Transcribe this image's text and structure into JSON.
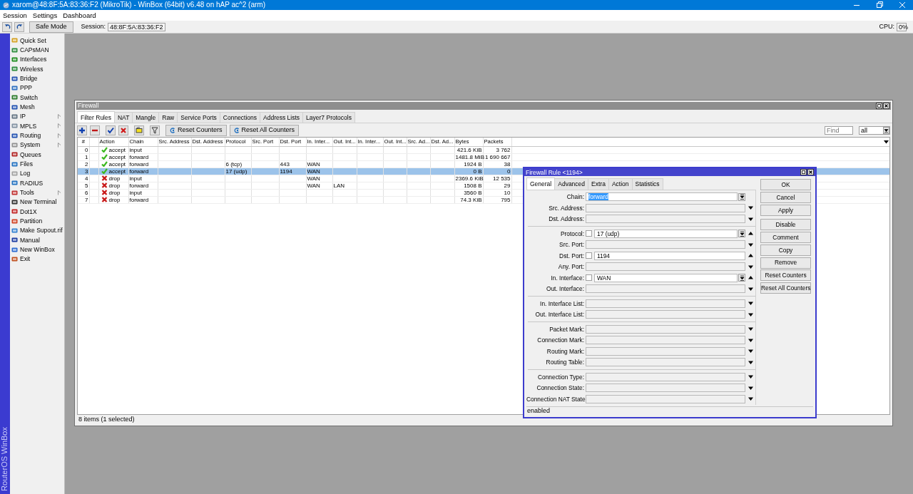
{
  "window": {
    "title": "xarom@48:8F:5A:83:36:F2 (MikroTik) - WinBox (64bit) v6.48 on hAP ac^2 (arm)"
  },
  "menu": [
    "Session",
    "Settings",
    "Dashboard"
  ],
  "toolbar": {
    "safe_mode": "Safe Mode",
    "session_label": "Session:",
    "session": "48:8F:5A:83:36:F2",
    "cpu_label": "CPU:",
    "cpu": "0%"
  },
  "sidebar": {
    "brand": "RouterOS WinBox",
    "items": [
      {
        "label": "Quick Set",
        "submenu": false
      },
      {
        "label": "CAPsMAN",
        "submenu": false
      },
      {
        "label": "Interfaces",
        "submenu": false
      },
      {
        "label": "Wireless",
        "submenu": false
      },
      {
        "label": "Bridge",
        "submenu": false
      },
      {
        "label": "PPP",
        "submenu": false
      },
      {
        "label": "Switch",
        "submenu": false
      },
      {
        "label": "Mesh",
        "submenu": false
      },
      {
        "label": "IP",
        "submenu": true
      },
      {
        "label": "MPLS",
        "submenu": true
      },
      {
        "label": "Routing",
        "submenu": true
      },
      {
        "label": "System",
        "submenu": true
      },
      {
        "label": "Queues",
        "submenu": false
      },
      {
        "label": "Files",
        "submenu": false
      },
      {
        "label": "Log",
        "submenu": false
      },
      {
        "label": "RADIUS",
        "submenu": false
      },
      {
        "label": "Tools",
        "submenu": true
      },
      {
        "label": "New Terminal",
        "submenu": false
      },
      {
        "label": "Dot1X",
        "submenu": false
      },
      {
        "label": "Partition",
        "submenu": false
      },
      {
        "label": "Make Supout.rif",
        "submenu": false
      },
      {
        "label": "Manual",
        "submenu": false
      },
      {
        "label": "New WinBox",
        "submenu": false
      },
      {
        "label": "Exit",
        "submenu": false
      }
    ]
  },
  "firewall": {
    "title": "Firewall",
    "tabs": [
      {
        "label": "Filter Rules",
        "selected": true
      },
      {
        "label": "NAT",
        "selected": false
      },
      {
        "label": "Mangle",
        "selected": false
      },
      {
        "label": "Raw",
        "selected": false
      },
      {
        "label": "Service Ports",
        "selected": false
      },
      {
        "label": "Connections",
        "selected": false
      },
      {
        "label": "Address Lists",
        "selected": false
      },
      {
        "label": "Layer7 Protocols",
        "selected": false
      }
    ],
    "buttons": [
      "Reset Counters",
      "Reset All Counters"
    ],
    "search": {
      "placeholder": "Find"
    },
    "filter": "all",
    "columns": [
      "#",
      "Action",
      "Chain",
      "Src. Address",
      "Dst. Address",
      "Protocol",
      "Src. Port",
      "Dst. Port",
      "In. Inter...",
      "Out. Int...",
      "In. Inter...",
      "Out. Int...",
      "Src. Ad...",
      "Dst. Ad...",
      "Bytes",
      "Packets"
    ],
    "rows": [
      {
        "number": "0",
        "kind": "accept",
        "action": "accept",
        "chain": "input",
        "bytes": "421.6 KiB",
        "packets": "3 762",
        "selected": false
      },
      {
        "number": "1",
        "kind": "accept",
        "action": "accept",
        "chain": "forward",
        "bytes": "1481.8 MiB",
        "packets": "1 690 667",
        "selected": false
      },
      {
        "number": "2",
        "kind": "accept",
        "action": "accept",
        "chain": "forward",
        "protocol": "6 (tcp)",
        "dst_port": "443",
        "in_interface": "WAN",
        "bytes": "1924 B",
        "packets": "38",
        "selected": false
      },
      {
        "number": "3",
        "kind": "accept",
        "action": "accept",
        "chain": "forward",
        "protocol": "17 (udp)",
        "dst_port": "1194",
        "in_interface": "WAN",
        "bytes": "0 B",
        "packets": "0",
        "selected": true
      },
      {
        "number": "4",
        "kind": "drop",
        "action": "drop",
        "chain": "input",
        "in_interface": "WAN",
        "bytes": "2369.6 KiB",
        "packets": "12 535",
        "selected": false
      },
      {
        "number": "5",
        "kind": "drop",
        "action": "drop",
        "chain": "forward",
        "in_interface": "WAN",
        "out_interface": "LAN",
        "bytes": "1508 B",
        "packets": "29",
        "selected": false
      },
      {
        "number": "6",
        "kind": "drop",
        "action": "drop",
        "chain": "input",
        "bytes": "3560 B",
        "packets": "10",
        "selected": false
      },
      {
        "number": "7",
        "kind": "drop",
        "action": "drop",
        "chain": "forward",
        "bytes": "74.3 KiB",
        "packets": "795",
        "selected": false
      }
    ],
    "status": "8 items (1 selected)"
  },
  "rule_dialog": {
    "title": "Firewall Rule <1194>",
    "tabs": [
      {
        "label": "General",
        "selected": true
      },
      {
        "label": "Advanced",
        "selected": false
      },
      {
        "label": "Extra",
        "selected": false
      },
      {
        "label": "Action",
        "selected": false
      },
      {
        "label": "Statistics",
        "selected": false
      }
    ],
    "groups": [
      {
        "fields": [
          {
            "label": "Chain:",
            "kind": "combo",
            "value": "forward",
            "value_selected": true
          },
          {
            "label": "Src. Address:",
            "kind": "plain",
            "expanded": false
          },
          {
            "label": "Dst. Address:",
            "kind": "plain",
            "expanded": false
          }
        ]
      },
      {
        "fields": [
          {
            "label": "Protocol:",
            "kind": "combo",
            "negation": {
              "checked": false
            },
            "value": "17 (udp)",
            "value_selected": false,
            "expanded": true
          },
          {
            "label": "Src. Port:",
            "kind": "plain",
            "expanded": false
          },
          {
            "label": "Dst. Port:",
            "kind": "plain",
            "negation": {
              "checked": false
            },
            "value": "1194",
            "value_selected": false,
            "expanded": true
          },
          {
            "label": "Any. Port:",
            "kind": "plain",
            "expanded": false
          },
          {
            "label": "In. Interface:",
            "kind": "combo",
            "negation": {
              "checked": false
            },
            "value": "WAN",
            "value_selected": false,
            "expanded": true
          },
          {
            "label": "Out. Interface:",
            "kind": "plain",
            "expanded": false
          }
        ]
      },
      {
        "fields": [
          {
            "label": "In. Interface List:",
            "kind": "plain",
            "expanded": false
          },
          {
            "label": "Out. Interface List:",
            "kind": "plain",
            "expanded": false
          }
        ]
      },
      {
        "fields": [
          {
            "label": "Packet Mark:",
            "kind": "plain",
            "expanded": false
          },
          {
            "label": "Connection Mark:",
            "kind": "plain",
            "expanded": false
          },
          {
            "label": "Routing Mark:",
            "kind": "plain",
            "expanded": false
          },
          {
            "label": "Routing Table:",
            "kind": "plain",
            "expanded": false
          }
        ]
      },
      {
        "fields": [
          {
            "label": "Connection Type:",
            "kind": "plain",
            "expanded": false
          },
          {
            "label": "Connection State:",
            "kind": "plain",
            "expanded": false
          },
          {
            "label": "Connection NAT State:",
            "kind": "plain",
            "expanded": false
          }
        ]
      }
    ],
    "buttons": [
      "OK",
      "Cancel",
      "Apply",
      "Disable",
      "Comment",
      "Copy",
      "Remove",
      "Reset Counters",
      "Reset All Counters"
    ],
    "status": "enabled"
  }
}
